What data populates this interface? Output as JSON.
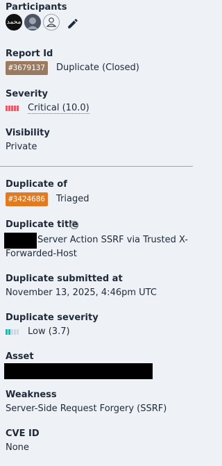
{
  "participants": {
    "label": "Participants",
    "avatars": [
      {
        "icon": "calligraphy-avatar",
        "text": "محمد"
      },
      {
        "icon": "portrait-avatar",
        "text": ""
      },
      {
        "icon": "default-user-avatar",
        "text": ""
      }
    ],
    "edit_icon": "pencil-icon"
  },
  "report": {
    "label": "Report Id",
    "id": "#3679137",
    "status": "Duplicate (Closed)"
  },
  "severity": {
    "label": "Severity",
    "value": "Critical (10.0)",
    "level_bars_filled": 5,
    "level_bars_total": 5,
    "color": "#e35d6a"
  },
  "visibility": {
    "label": "Visibility",
    "value": "Private"
  },
  "duplicate_of": {
    "label": "Duplicate of",
    "id": "#3424686",
    "status": "Triaged"
  },
  "duplicate_title": {
    "label": "Duplicate title",
    "help_icon": "question-circle-icon",
    "text_line1": "Server Action SSRF via Trusted X-",
    "text_line2": "Forwarded-Host"
  },
  "duplicate_submitted": {
    "label": "Duplicate submitted at",
    "value": "November 13, 2025, 4:46pm UTC"
  },
  "duplicate_severity": {
    "label": "Duplicate severity",
    "value": "Low (3.7)",
    "level_bars_filled": 2,
    "level_bars_total": 5,
    "color": "#2bb5a8"
  },
  "asset": {
    "label": "Asset"
  },
  "weakness": {
    "label": "Weakness",
    "value": "Server-Side Request Forgery (SSRF)"
  },
  "cve": {
    "label": "CVE ID",
    "value": "None"
  }
}
